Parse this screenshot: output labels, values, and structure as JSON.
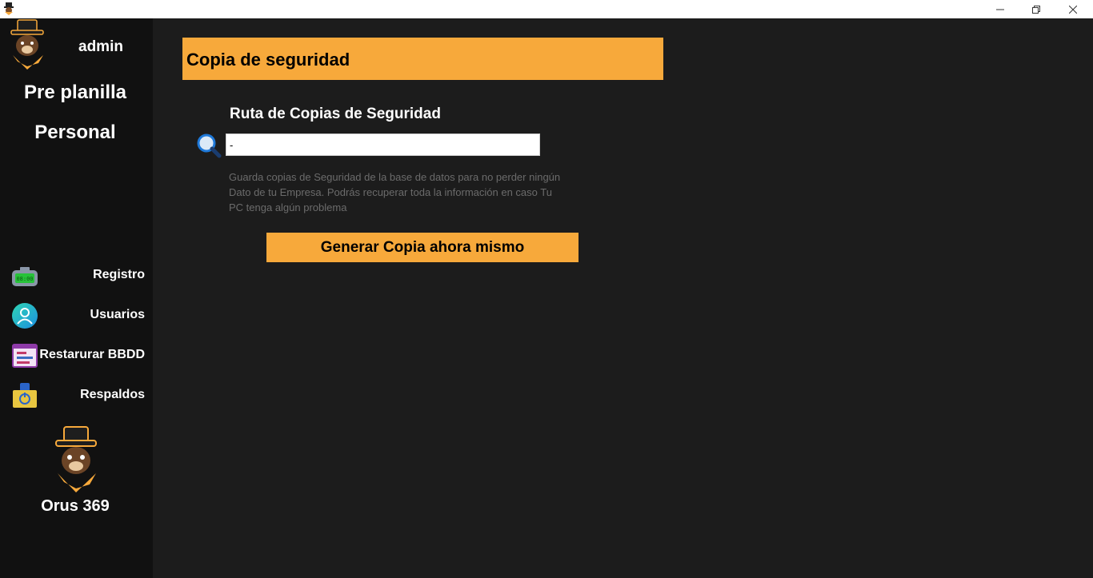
{
  "window": {
    "minimize_glyph": "—",
    "maximize_glyph": "❐",
    "close_glyph": "✕"
  },
  "sidebar": {
    "username": "admin",
    "nav_pre_planilla": "Pre planilla",
    "nav_personal": "Personal",
    "items": [
      {
        "label": "Registro",
        "icon": "clock-icon"
      },
      {
        "label": "Usuarios",
        "icon": "user-icon"
      },
      {
        "label": "Restarurar BBDD",
        "icon": "database-restore-icon"
      },
      {
        "label": "Respaldos",
        "icon": "backup-folder-icon"
      }
    ],
    "brand_name": "Orus 369"
  },
  "main": {
    "header_title": "Copia de seguridad",
    "section_label": "Ruta de Copias de Seguridad",
    "path_input_value": "-",
    "help_text": "Guarda copias de Seguridad de la base de datos para no perder ningún Dato de tu Empresa. Podrás recuperar toda la información en caso Tu PC tenga algún problema",
    "generate_button": "Generar Copia ahora mismo"
  },
  "colors": {
    "accent": "#f7a93b",
    "background": "#1c1c1c",
    "sidebar": "#111111"
  }
}
